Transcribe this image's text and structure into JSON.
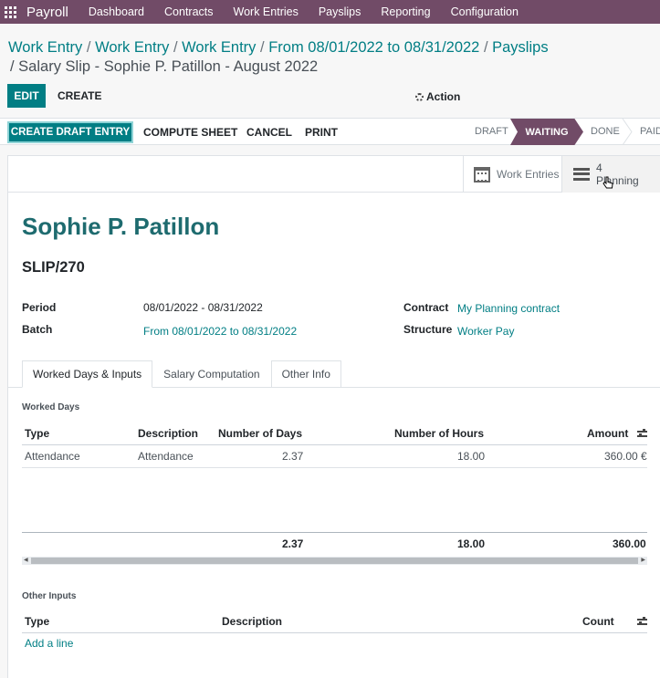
{
  "topnav": {
    "app": "Payroll",
    "items": [
      "Dashboard",
      "Contracts",
      "Work Entries",
      "Payslips",
      "Reporting",
      "Configuration"
    ]
  },
  "breadcrumb": {
    "crumbs": [
      "Work Entry",
      "Work Entry",
      "Work Entry",
      "From 08/01/2022 to 08/31/2022",
      "Payslips"
    ],
    "current": "Salary Slip - Sophie P. Patillon - August 2022"
  },
  "control": {
    "edit": "EDIT",
    "create": "CREATE",
    "action": "Action"
  },
  "statusbar": {
    "create_draft": "CREATE DRAFT ENTRY",
    "compute": "COMPUTE SHEET",
    "cancel": "CANCEL",
    "print": "PRINT",
    "stages": [
      "DRAFT",
      "WAITING",
      "DONE",
      "PAID"
    ],
    "active_stage": "WAITING"
  },
  "smart_buttons": {
    "work_entries": "Work Entries",
    "planning_count": "4",
    "planning_label": "Planning"
  },
  "form": {
    "employee": "Sophie P. Patillon",
    "reference": "SLIP/270",
    "period_label": "Period",
    "period": "08/01/2022 - 08/31/2022",
    "batch_label": "Batch",
    "batch": "From 08/01/2022 to 08/31/2022",
    "contract_label": "Contract",
    "contract": "My Planning contract",
    "structure_label": "Structure",
    "structure": "Worker Pay"
  },
  "tabs": [
    "Worked Days & Inputs",
    "Salary Computation",
    "Other Info"
  ],
  "worked_days": {
    "title": "Worked Days",
    "headers": [
      "Type",
      "Description",
      "Number of Days",
      "Number of Hours",
      "Amount"
    ],
    "rows": [
      {
        "type": "Attendance",
        "description": "Attendance",
        "days": "2.37",
        "hours": "18.00",
        "amount": "360.00 €"
      }
    ],
    "totals": {
      "days": "2.37",
      "hours": "18.00",
      "amount": "360.00"
    }
  },
  "other_inputs": {
    "title": "Other Inputs",
    "headers": [
      "Type",
      "Description",
      "Count"
    ],
    "add_line": "Add a line"
  },
  "colors": {
    "brand": "#714b67",
    "accent": "#017e84"
  }
}
